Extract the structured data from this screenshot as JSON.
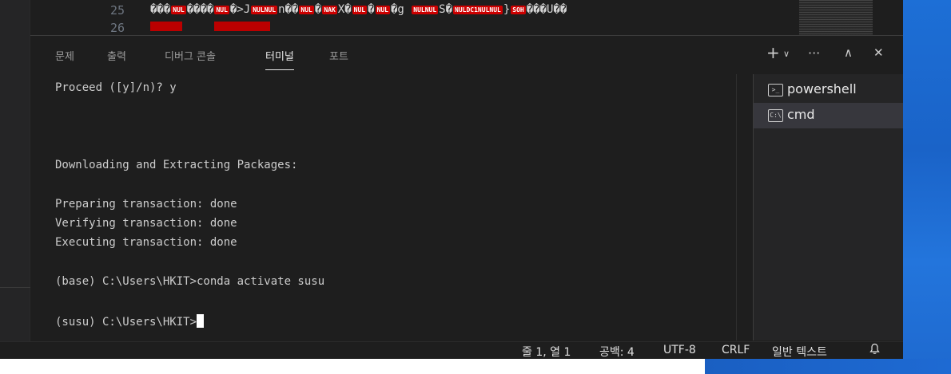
{
  "editor": {
    "line_numbers": [
      "25",
      "26"
    ],
    "line25_ctrl_tags": [
      "NUL",
      "NUL",
      "NULNUL",
      "NUL",
      "NAK",
      "NUL",
      "NUL",
      "NULNUL",
      "NULDC1NULNUL",
      "SOH"
    ]
  },
  "panel": {
    "tabs": [
      "문제",
      "출력",
      "디버그 콘솔",
      "터미널",
      "포트"
    ],
    "active_tab": "터미널"
  },
  "terminal": {
    "lines": [
      "Proceed ([y]/n)? y",
      "Downloading and Extracting Packages:",
      "Preparing transaction: done",
      "Verifying transaction: done",
      "Executing transaction: done",
      "(base) C:\\Users\\HKIT>conda activate susu",
      "(susu) C:\\Users\\HKIT>"
    ]
  },
  "terminal_list": [
    {
      "label": "powershell",
      "icon": "powershell-icon"
    },
    {
      "label": "cmd",
      "icon": "cmd-icon",
      "selected": true
    }
  ],
  "statusbar": {
    "position": "줄 1, 열 1",
    "spaces": "공백: 4",
    "encoding": "UTF-8",
    "eol": "CRLF",
    "language": "일반 텍스트"
  },
  "colors": {
    "panel_bg": "#1e1e1e",
    "list_selected": "#37373d",
    "ctrl_badge": "#cc0000",
    "wallpaper": "#1d6fd6"
  }
}
